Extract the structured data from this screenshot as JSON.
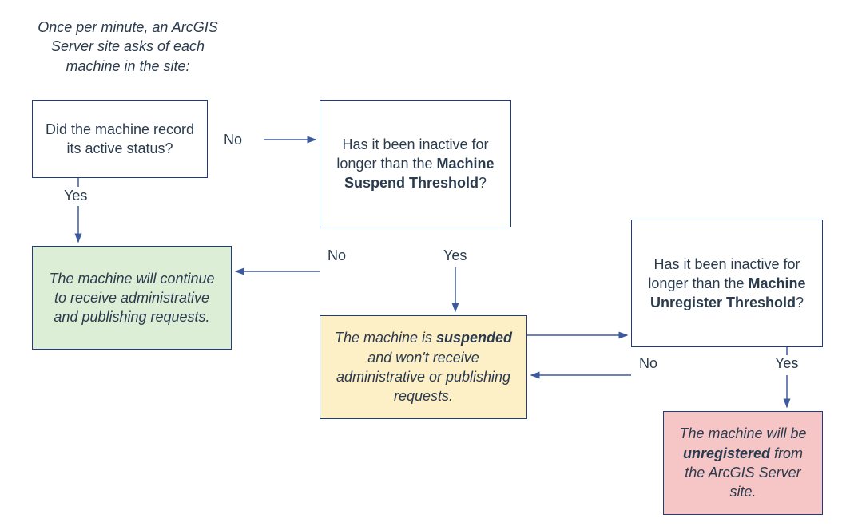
{
  "intro": "Once per minute, an ArcGIS Server site asks of each machine in the site:",
  "boxes": {
    "q1": "Did the machine record its active status?",
    "q2_pre": "Has it been inactive for longer than the ",
    "q2_bold": "Machine Suspend Threshold",
    "q2_post": "?",
    "q3_pre": "Has it been inactive for longer than the ",
    "q3_bold": "Machine Unregister Threshold",
    "q3_post": "?",
    "r_green": "The machine will continue to receive administrative and publishing requests.",
    "r_yellow_pre": "The machine is ",
    "r_yellow_bold": "suspended",
    "r_yellow_post": " and won't receive administrative or publishing requests.",
    "r_red_pre": "The machine will be ",
    "r_red_bold": "unregistered",
    "r_red_post": " from the ArcGIS Server site."
  },
  "labels": {
    "yes": "Yes",
    "no": "No"
  },
  "colors": {
    "border": "#1f3d7a",
    "green": "#dceed6",
    "yellow": "#fdefc6",
    "red": "#f6c6c6",
    "arrow": "#3d5a9e"
  }
}
